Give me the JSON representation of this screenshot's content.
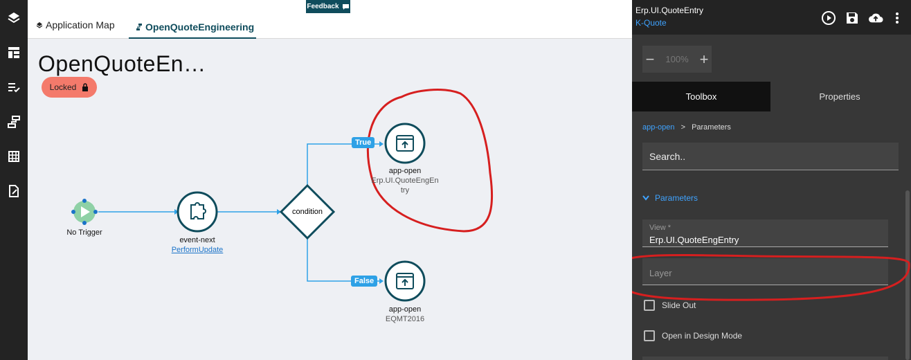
{
  "canvas_tabs": [
    {
      "label": "Application Map"
    },
    {
      "label": "OpenQuoteEngineering"
    }
  ],
  "feedback_label": "Feedback",
  "page_title": "OpenQuoteEn…",
  "locked_label": "Locked",
  "flow": {
    "start_label": "No Trigger",
    "event_title": "event-next",
    "event_link": "PerformUpdate",
    "condition_label": "condition",
    "true_label": "True",
    "false_label": "False",
    "true_node_title": "app-open",
    "true_node_sub1": "Erp.UI.QuoteEngEn",
    "true_node_sub2": "try",
    "false_node_title": "app-open",
    "false_node_sub": "EQMT2016"
  },
  "panel": {
    "title": "Erp.UI.QuoteEntry",
    "subtitle": "K-Quote",
    "zoom_value": "100%",
    "zoom_minus": "−",
    "zoom_plus": "+",
    "tabs": [
      {
        "label": "Toolbox"
      },
      {
        "label": "Properties"
      }
    ],
    "breadcrumb_root": "app-open",
    "breadcrumb_sep": ">",
    "breadcrumb_current": "Parameters",
    "search_placeholder": "Search..",
    "section_label": "Parameters",
    "view_label": "View *",
    "view_value": "Erp.UI.QuoteEngEntry",
    "layer_label": "Layer",
    "slide_out_label": "Slide Out",
    "open_design_label": "Open in Design Mode"
  },
  "colors": {
    "accent": "#0f4c5c",
    "link": "#3fa3ff",
    "flow_line": "#2ea1e6",
    "annotation": "#d61f1f"
  }
}
